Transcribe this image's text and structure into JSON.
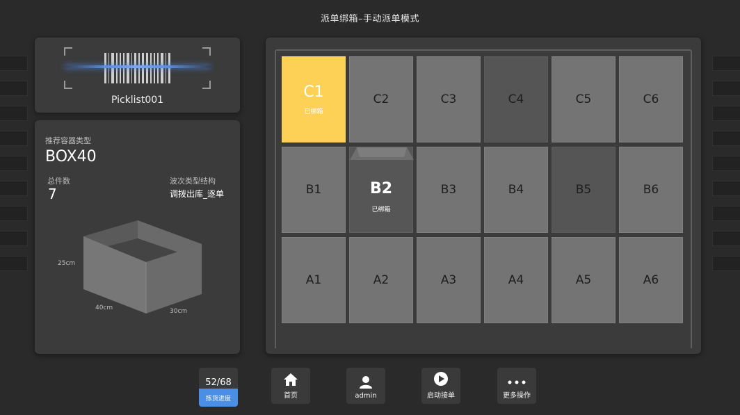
{
  "header": {
    "title": "派单绑箱–手动派单模式"
  },
  "scan": {
    "picklist": "Picklist001"
  },
  "info": {
    "container_type_label": "推荐容器类型",
    "container_type": "BOX40",
    "count_label": "总件数",
    "count": "7",
    "wave_label": "波次类型结构",
    "wave_value": "调拨出库_逐单",
    "dims": {
      "height": "25cm",
      "length": "40cm",
      "width": "30cm"
    }
  },
  "grid": {
    "bound_label": "已绑箱",
    "rows": [
      [
        "C1",
        "C2",
        "C3",
        "C4",
        "C5",
        "C6"
      ],
      [
        "B1",
        "B2",
        "B3",
        "B4",
        "B5",
        "B6"
      ],
      [
        "A1",
        "A2",
        "A3",
        "A4",
        "A5",
        "A6"
      ]
    ]
  },
  "toolbar": {
    "progress_count": "52/68",
    "progress_label": "拣货进度",
    "home_label": "首页",
    "user_label": "admin",
    "start_label": "启动接单",
    "more_label": "更多操作"
  }
}
